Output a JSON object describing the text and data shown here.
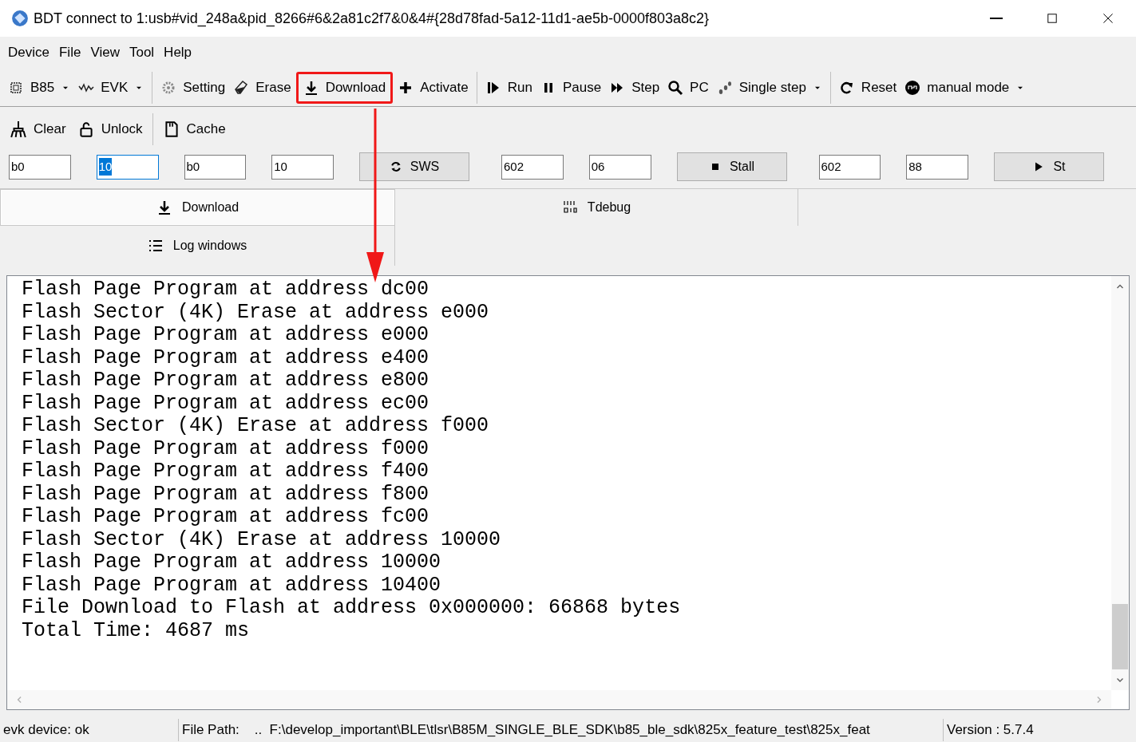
{
  "window": {
    "title": "BDT connect to 1:usb#vid_248a&pid_8266#6&2a81c2f7&0&4#{28d78fad-5a12-11d1-ae5b-0000f803a8c2}"
  },
  "menu": [
    "Device",
    "File",
    "View",
    "Tool",
    "Help"
  ],
  "toolbar": [
    [
      {
        "label": "B85",
        "kind": "dropdown",
        "highlighted": false
      },
      {
        "label": "EVK",
        "kind": "dropdown",
        "highlighted": false
      }
    ],
    [
      {
        "label": "Setting",
        "kind": "button",
        "highlighted": false
      },
      {
        "label": "Erase",
        "kind": "button",
        "highlighted": false
      },
      {
        "label": "Download",
        "kind": "button",
        "highlighted": true
      },
      {
        "label": "Activate",
        "kind": "button",
        "highlighted": false
      }
    ],
    [
      {
        "label": "Run",
        "kind": "button",
        "highlighted": false
      },
      {
        "label": "Pause",
        "kind": "button",
        "highlighted": false
      },
      {
        "label": "Step",
        "kind": "button",
        "highlighted": false
      },
      {
        "label": "PC",
        "kind": "button",
        "highlighted": false
      },
      {
        "label": "Single step",
        "kind": "dropdown",
        "highlighted": false
      }
    ],
    [
      {
        "label": "Reset",
        "kind": "button",
        "highlighted": false
      },
      {
        "label": "manual mode",
        "kind": "dropdown",
        "highlighted": false
      }
    ]
  ],
  "toolbar2": [
    [
      {
        "label": "Clear"
      },
      {
        "label": "Unlock"
      }
    ],
    [
      {
        "label": "Cache"
      }
    ]
  ],
  "controls": [
    {
      "kind": "field",
      "value": "b0",
      "focused": false
    },
    {
      "kind": "field",
      "value": "10",
      "focused": true
    },
    {
      "kind": "field",
      "value": "b0",
      "focused": false
    },
    {
      "kind": "field",
      "value": "10",
      "focused": false
    },
    {
      "kind": "button",
      "label": "SWS"
    },
    {
      "kind": "field",
      "value": "602",
      "focused": false
    },
    {
      "kind": "field",
      "value": "06",
      "focused": false
    },
    {
      "kind": "button",
      "label": "Stall"
    },
    {
      "kind": "field",
      "value": "602",
      "focused": false
    },
    {
      "kind": "field",
      "value": "88",
      "focused": false
    },
    {
      "kind": "button",
      "label": "St"
    }
  ],
  "tabs": [
    {
      "label": "Download",
      "selected": true
    },
    {
      "label": "Tdebug",
      "selected": false
    },
    {
      "label": "Log windows",
      "selected": false
    }
  ],
  "log": [
    "Flash Page Program at address dc00",
    "Flash Sector (4K) Erase at address e000",
    "Flash Page Program at address e000",
    "Flash Page Program at address e400",
    "Flash Page Program at address e800",
    "Flash Page Program at address ec00",
    "Flash Sector (4K) Erase at address f000",
    "Flash Page Program at address f000",
    "Flash Page Program at address f400",
    "Flash Page Program at address f800",
    "Flash Page Program at address fc00",
    "Flash Sector (4K) Erase at address 10000",
    "Flash Page Program at address 10000",
    "Flash Page Program at address 10400",
    "File Download to Flash at address 0x000000: 66868 bytes",
    "Total Time: 4687 ms"
  ],
  "status_bar": [
    "evk device: ok",
    "File Path:    ..  F:\\develop_important\\BLE\\tlsr\\B85M_SINGLE_BLE_SDK\\b85_ble_sdk\\825x_feature_test\\825x_feat",
    "Version : 5.7.4"
  ]
}
